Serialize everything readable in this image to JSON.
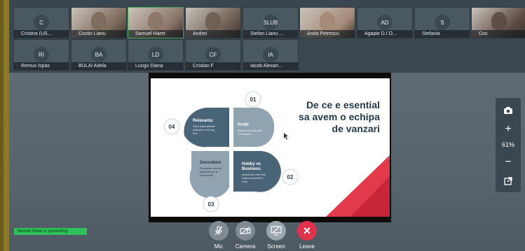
{
  "participants_row1": [
    {
      "initials": "C",
      "name": "Cristina (US...",
      "photo": false
    },
    {
      "initials": "",
      "name": "Costin Lianu",
      "photo": true,
      "tone": "#7d6a5a"
    },
    {
      "initials": "",
      "name": "Samuel Haret",
      "photo": true,
      "tone": "#8b7466",
      "speaking": true
    },
    {
      "initials": "",
      "name": "Andrei",
      "photo": true,
      "tone": "#6d5d52"
    },
    {
      "initials": "SLUB",
      "name": "Stefan Lianu ...",
      "photo": false
    },
    {
      "initials": "",
      "name": "Anda Petrescu",
      "photo": true,
      "tone": "#a58a78"
    },
    {
      "initials": "AD",
      "name": "Agapie D./ O...",
      "photo": false
    },
    {
      "initials": "S",
      "name": "Stefania",
      "photo": false
    },
    {
      "initials": "",
      "name": "Cos",
      "photo": true,
      "tone": "#5b4a42"
    }
  ],
  "participants_row2": [
    {
      "initials": "RI",
      "name": "Remus Ispas"
    },
    {
      "initials": "BA",
      "name": "BULAI Adela"
    },
    {
      "initials": "LD",
      "name": "Lungu Diana"
    },
    {
      "initials": "CF",
      "name": "Cristian F"
    },
    {
      "initials": "IA",
      "name": "Iacob Alexan..."
    }
  ],
  "slide": {
    "title_line1": "De ce e esential",
    "title_line2": "sa avem o echipa",
    "title_line3": "de vanzari",
    "n01": "01",
    "n02": "02",
    "n03": "03",
    "n04": "04",
    "q1_title": "Relevanta",
    "q1_text1": "Ofera sustenabilitate",
    "q1_text2": "strategica si de long",
    "q1_text3": "term",
    "q2_title": "Profit",
    "q2_text1": "Asigura sursa de profit",
    "q2_text2": "in companie",
    "q3_title": "Dezvoltare",
    "q3_text1": "Finanteaza celor alt",
    "q3_text2": "departamente ai",
    "q3_text3": "businessului",
    "q4_title": "Hobby vs",
    "q4_title2": "Business",
    "q4_text1": "Alcatuit prin care este",
    "q4_text2": "impact sustenabil in",
    "q4_text3": "lume"
  },
  "zoom": {
    "level": "61%"
  },
  "controls": {
    "mic": "Mic",
    "camera": "Camera",
    "screen": "Screen",
    "leave": "Leave"
  },
  "status": {
    "presenting": "Samuel Haret is presenting"
  },
  "colors": {
    "leave": "#e0324a",
    "speaking": "#3ea34e",
    "slide_dark": "#4a6477",
    "slide_light": "#8fa3b1",
    "accent_red": "#e23a4a"
  }
}
